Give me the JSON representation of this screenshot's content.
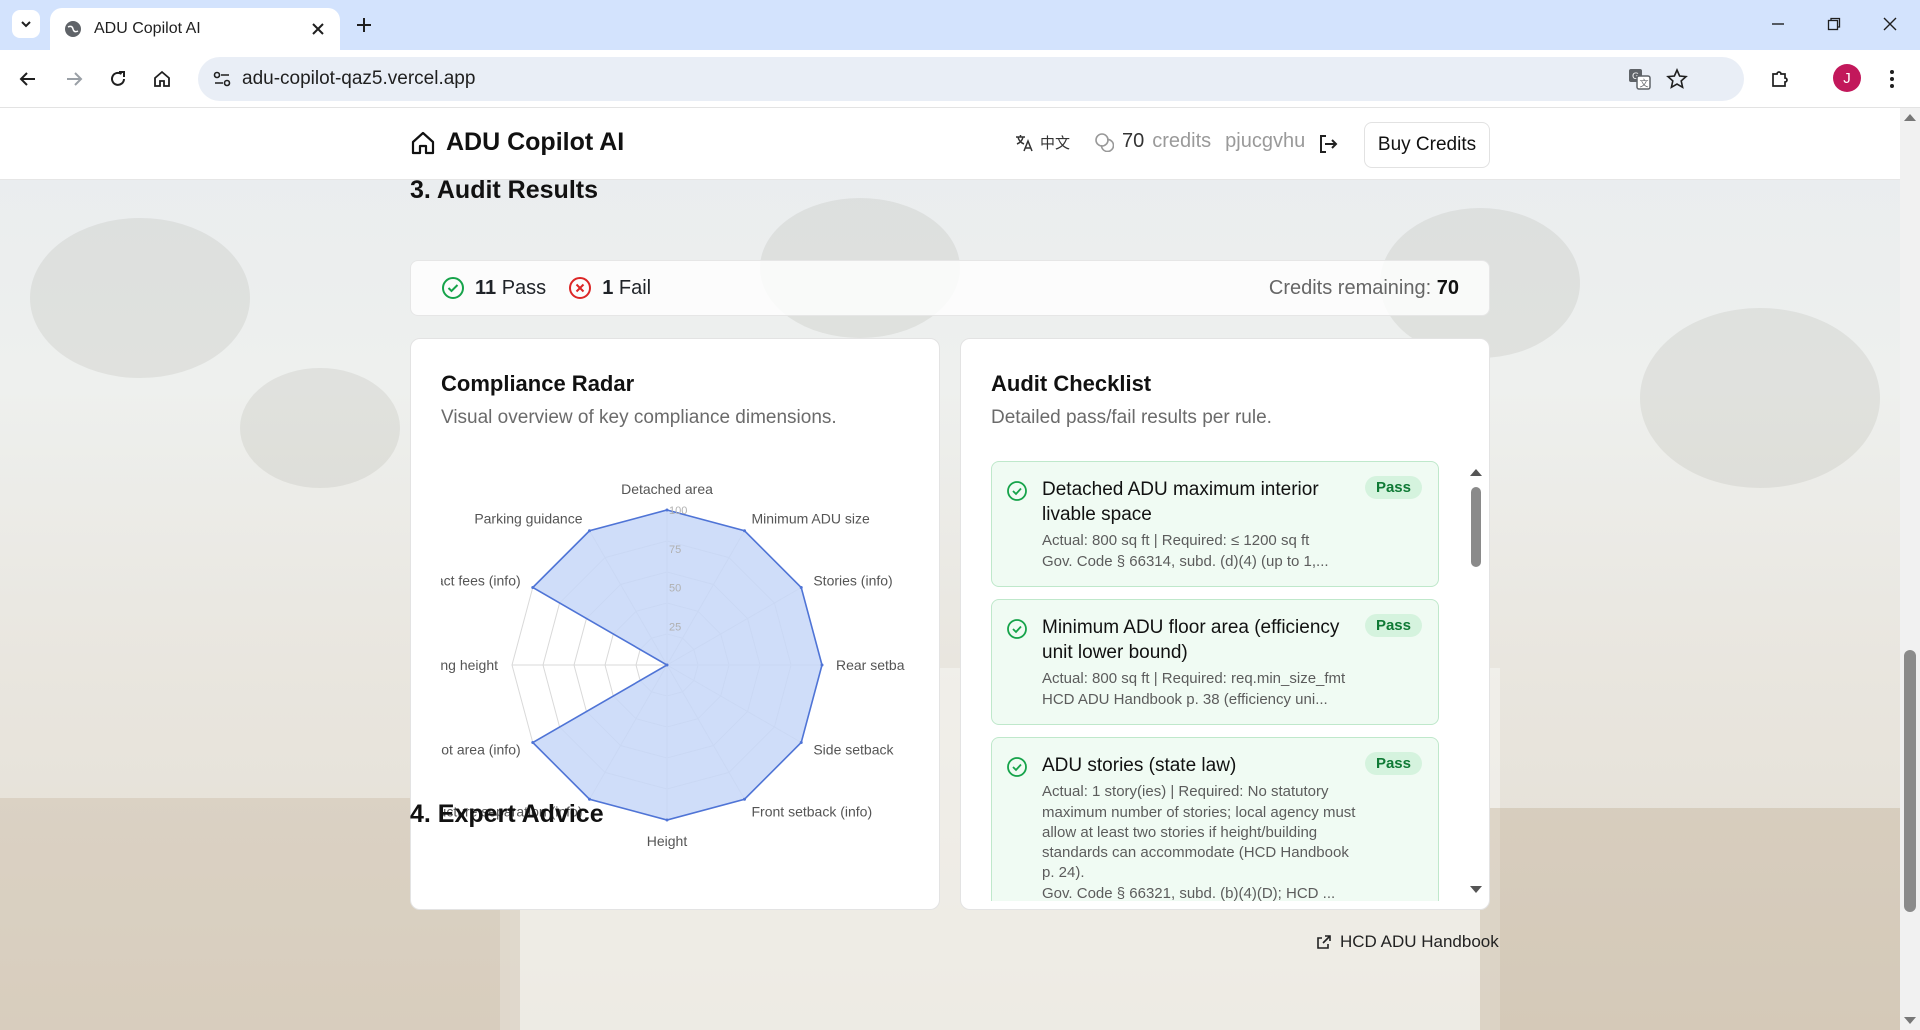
{
  "browser": {
    "tab_title": "ADU Copilot AI",
    "url": "adu-copilot-qaz5.vercel.app",
    "profile_initial": "J"
  },
  "header": {
    "brand": "ADU Copilot AI",
    "language": "中文",
    "credits_count": "70",
    "credits_unit": "credits",
    "username": "pjucgvhu",
    "buy_label": "Buy Credits"
  },
  "audit": {
    "title": "3. Audit Results",
    "pass_count": "11",
    "pass_label": "Pass",
    "fail_count": "1",
    "fail_label": "Fail",
    "remaining_label": "Credits remaining:",
    "remaining_value": "70"
  },
  "radar_card": {
    "title": "Compliance Radar",
    "description": "Visual overview of key compliance dimensions."
  },
  "checklist_card": {
    "title": "Audit Checklist",
    "description": "Detailed pass/fail results per rule.",
    "items": [
      {
        "rule": "Detached ADU maximum interior livable space",
        "status": "Pass",
        "detail_1": "Actual: 800 sq ft | Required: ≤ 1200 sq ft",
        "detail_2": "Gov. Code § 66314, subd. (d)(4) (up to 1,..."
      },
      {
        "rule": "Minimum ADU floor area (efficiency unit lower bound)",
        "status": "Pass",
        "detail_1": "Actual: 800 sq ft | Required: req.min_size_fmt",
        "detail_2": "HCD ADU Handbook p. 38 (efficiency uni..."
      },
      {
        "rule": "ADU stories (state law)",
        "status": "Pass",
        "detail_1": "Actual: 1 story(ies) | Required: No statutory maximum number of stories; local agency must allow at least two stories if height/building standards can accommodate (HCD Handbook p. 24).",
        "detail_2": "Gov. Code § 66321, subd. (b)(4)(D); HCD ..."
      }
    ]
  },
  "links": {
    "handbook": "HCD ADU Handbook"
  },
  "next_section": {
    "title": "4. Expert Advice"
  },
  "colors": {
    "radar_fill": "#c7d7f8",
    "radar_stroke": "#4f74d6",
    "pass_green": "#0f7a35",
    "fail_red": "#dc2626"
  },
  "chart_data": {
    "type": "radar",
    "title": "",
    "axes": [
      "Detached area",
      "Minimum ADU size",
      "Stories (info)",
      "Rear setback",
      "Side setback",
      "Front setback (info)",
      "Height",
      "Structure separation (info)",
      "Lot area (info)",
      "Building height",
      "Impact fees (info)",
      "Parking guidance"
    ],
    "axis_labels_shown": [
      "Detached area",
      "Minimum ADU size",
      "Stories (info)",
      "Rear setba",
      "Side setback",
      "Front setback (info)",
      "Height",
      "ucture separation (info)",
      "Lot area (info)",
      "ing height",
      "act fees (info)",
      "Parking guidance"
    ],
    "values": [
      100,
      100,
      100,
      100,
      100,
      100,
      100,
      100,
      100,
      0,
      100,
      100
    ],
    "radial_ticks": [
      "25",
      "50",
      "75",
      "100"
    ],
    "range": [
      0,
      100
    ]
  }
}
